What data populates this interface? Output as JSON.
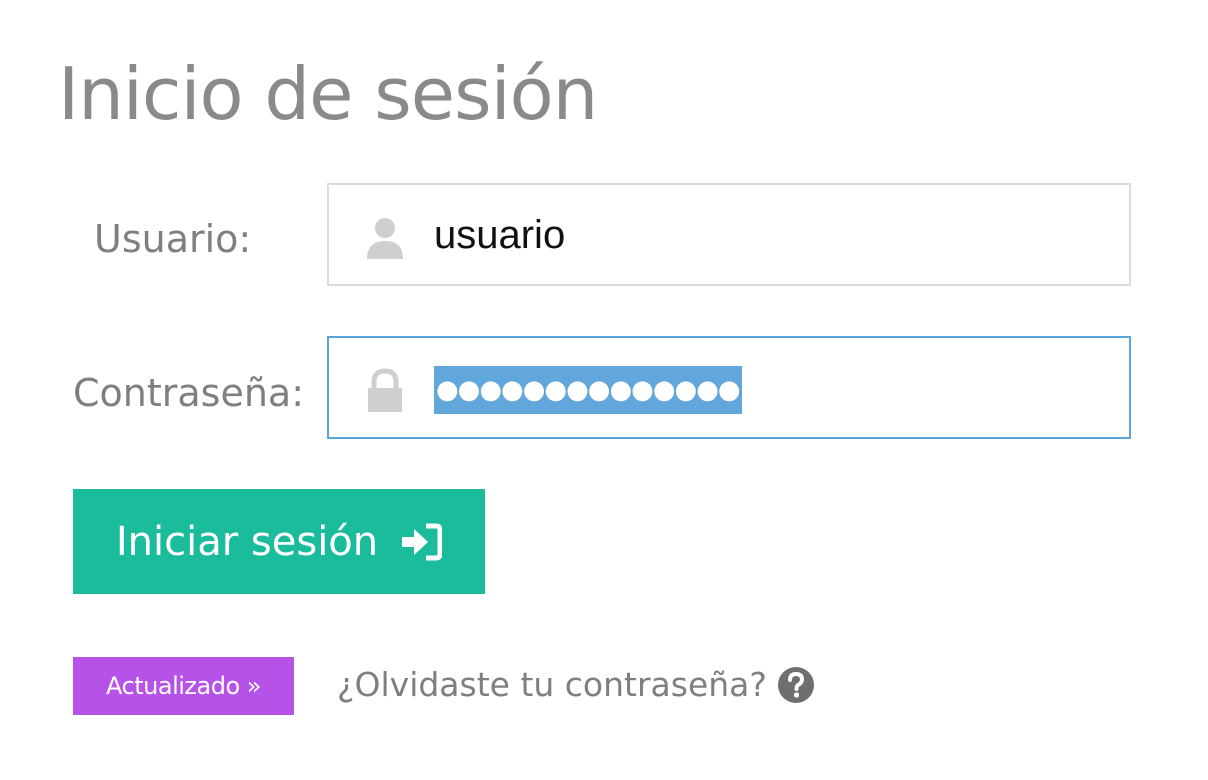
{
  "page": {
    "title": "Inicio de sesión"
  },
  "form": {
    "username_label": "Usuario:",
    "username_value": "usuario",
    "password_label": "Contraseña:",
    "password_mask": "●●●●●●●●●●●●●●"
  },
  "actions": {
    "login_label": "Iniciar sesión",
    "updated_badge": "Actualizado »",
    "forgot_label": "¿Olvidaste tu contraseña?"
  },
  "icons": {
    "user": "user-icon",
    "lock": "lock-icon",
    "sign_in": "sign-in-icon",
    "help": "question-circle-icon"
  },
  "colors": {
    "accent_button": "#1abc9c",
    "badge": "#b652e8",
    "focus_border": "#5aa6d6",
    "selection": "#62a7dc",
    "label_text": "#7f7f7f"
  }
}
